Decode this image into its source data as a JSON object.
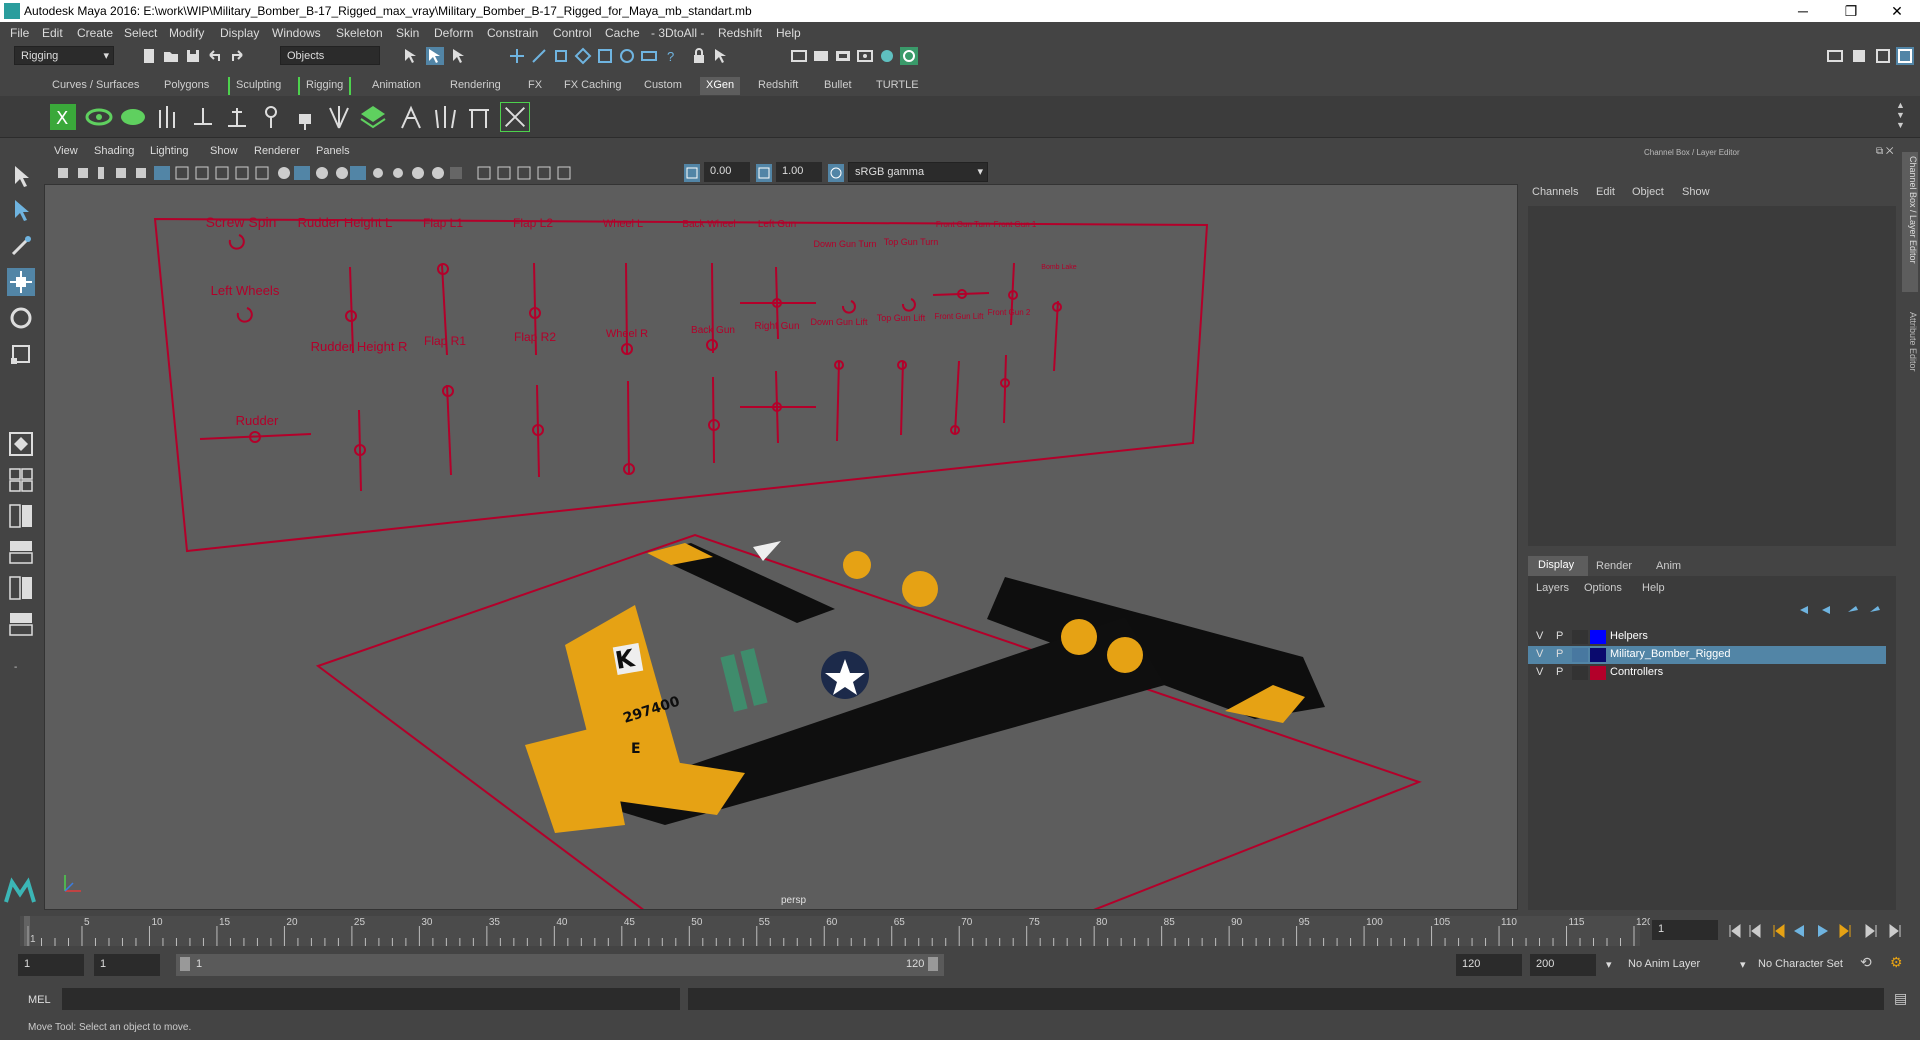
{
  "window": {
    "title": "Autodesk Maya 2016: E:\\work\\WIP\\Military_Bomber_B-17_Rigged_max_vray\\Military_Bomber_B-17_Rigged_for_Maya_mb_standart.mb",
    "minimize": "─",
    "maximize": "❐",
    "close": "✕"
  },
  "menu": [
    "File",
    "Edit",
    "Create",
    "Select",
    "Modify",
    "Display",
    "Windows",
    "Skeleton",
    "Skin",
    "Deform",
    "Constrain",
    "Control",
    "Cache",
    "- 3DtoAll -",
    "Redshift",
    "Help"
  ],
  "statusline": {
    "menuset": "Rigging",
    "selection_mode": "Objects"
  },
  "shelf_tabs": [
    "Curves / Surfaces",
    "Polygons",
    "Sculpting",
    "Rigging",
    "Animation",
    "Rendering",
    "FX",
    "FX Caching",
    "Custom",
    "XGen",
    "Redshift",
    "Bullet",
    "TURTLE"
  ],
  "active_shelf_tab": "XGen",
  "viewport": {
    "menu": [
      "View",
      "Shading",
      "Lighting",
      "Show",
      "Renderer",
      "Panels"
    ],
    "exposure": "0.00",
    "gamma": "1.00",
    "colorspace": "sRGB gamma",
    "camera": "persp",
    "controllers": {
      "labels": [
        "Screw Spin",
        "Rudder Height L",
        "Flap L1",
        "Flap L2",
        "Wheel L",
        "Back Wheel",
        "Left Gun",
        "Down Gun Turn",
        "Top Gun Turn",
        "Front Gun Turn",
        "Front Gun 1",
        "Bomb Lake",
        "Left Wheels",
        "Rudder Height R",
        "Flap R1",
        "Flap R2",
        "Wheel R",
        "Back Gun",
        "Right Gun",
        "Down Gun Lift",
        "Top Gun Lift",
        "Front Gun Lift",
        "Front Gun 2",
        "Rudder"
      ]
    },
    "plane": {
      "tail_letter": "K",
      "tail_number": "297400",
      "tail_sub": "E"
    }
  },
  "channel_box": {
    "title": "Channel Box / Layer Editor",
    "menu": [
      "Channels",
      "Edit",
      "Object",
      "Show"
    ]
  },
  "layer_editor": {
    "tabs": [
      "Display",
      "Render",
      "Anim"
    ],
    "menu": [
      "Layers",
      "Options",
      "Help"
    ],
    "layers": [
      {
        "v": "V",
        "p": "P",
        "name": "Helpers",
        "color": "#0000ff",
        "selected": false
      },
      {
        "v": "V",
        "p": "P",
        "name": "Military_Bomber_Rigged",
        "color": "#0a0a6e",
        "selected": true
      },
      {
        "v": "V",
        "p": "P",
        "name": "Controllers",
        "color": "#b3002a",
        "selected": false
      }
    ]
  },
  "side_tabs": [
    "Channel Box / Layer Editor",
    "Attribute Editor"
  ],
  "timeline": {
    "ticks": [
      "1",
      "5",
      "10",
      "15",
      "20",
      "25",
      "30",
      "35",
      "40",
      "45",
      "50",
      "55",
      "60",
      "65",
      "70",
      "75",
      "80",
      "85",
      "90",
      "95",
      "100",
      "105",
      "110",
      "115",
      "120"
    ],
    "current_frame": "1"
  },
  "range": {
    "start": "1",
    "start_inner": "1",
    "range_start_label": "1",
    "range_end_label": "120",
    "end_inner": "120",
    "end": "200",
    "anim_layer": "No Anim Layer",
    "char_set": "No Character Set"
  },
  "cmdline": {
    "lang": "MEL"
  },
  "helpline": {
    "text": "Move Tool: Select an object to move."
  },
  "colors": {
    "accent": "#5285a6",
    "controller": "#b3002a",
    "plane_yellow": "#e6a214",
    "viewport_bg": "#5d5d5d"
  }
}
